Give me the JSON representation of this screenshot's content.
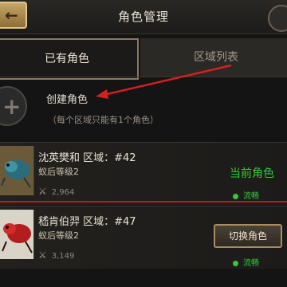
{
  "header": {
    "title": "角色管理"
  },
  "tabs": [
    {
      "label": "已有角色",
      "active": true
    },
    {
      "label": "区域列表",
      "active": false
    }
  ],
  "create": {
    "label": "创建角色",
    "hint": "（每个区域只能有1个角色）"
  },
  "characters": [
    {
      "name_line": "沈英樊和 区域：#42",
      "level": "蚁后等级2",
      "power": "2,964",
      "current_label": "当前角色",
      "status": "流畅",
      "portrait": "blue-ant"
    },
    {
      "name_line": "嵇肯伯羿 区域：#47",
      "level": "蚁后等级2",
      "power": "3,149",
      "button_label": "切换角色",
      "status": "流畅",
      "portrait": "red-ant"
    }
  ],
  "colors": {
    "accent_green": "#35c83b",
    "arrow_red": "#d42020",
    "gold": "#a88d5e"
  }
}
